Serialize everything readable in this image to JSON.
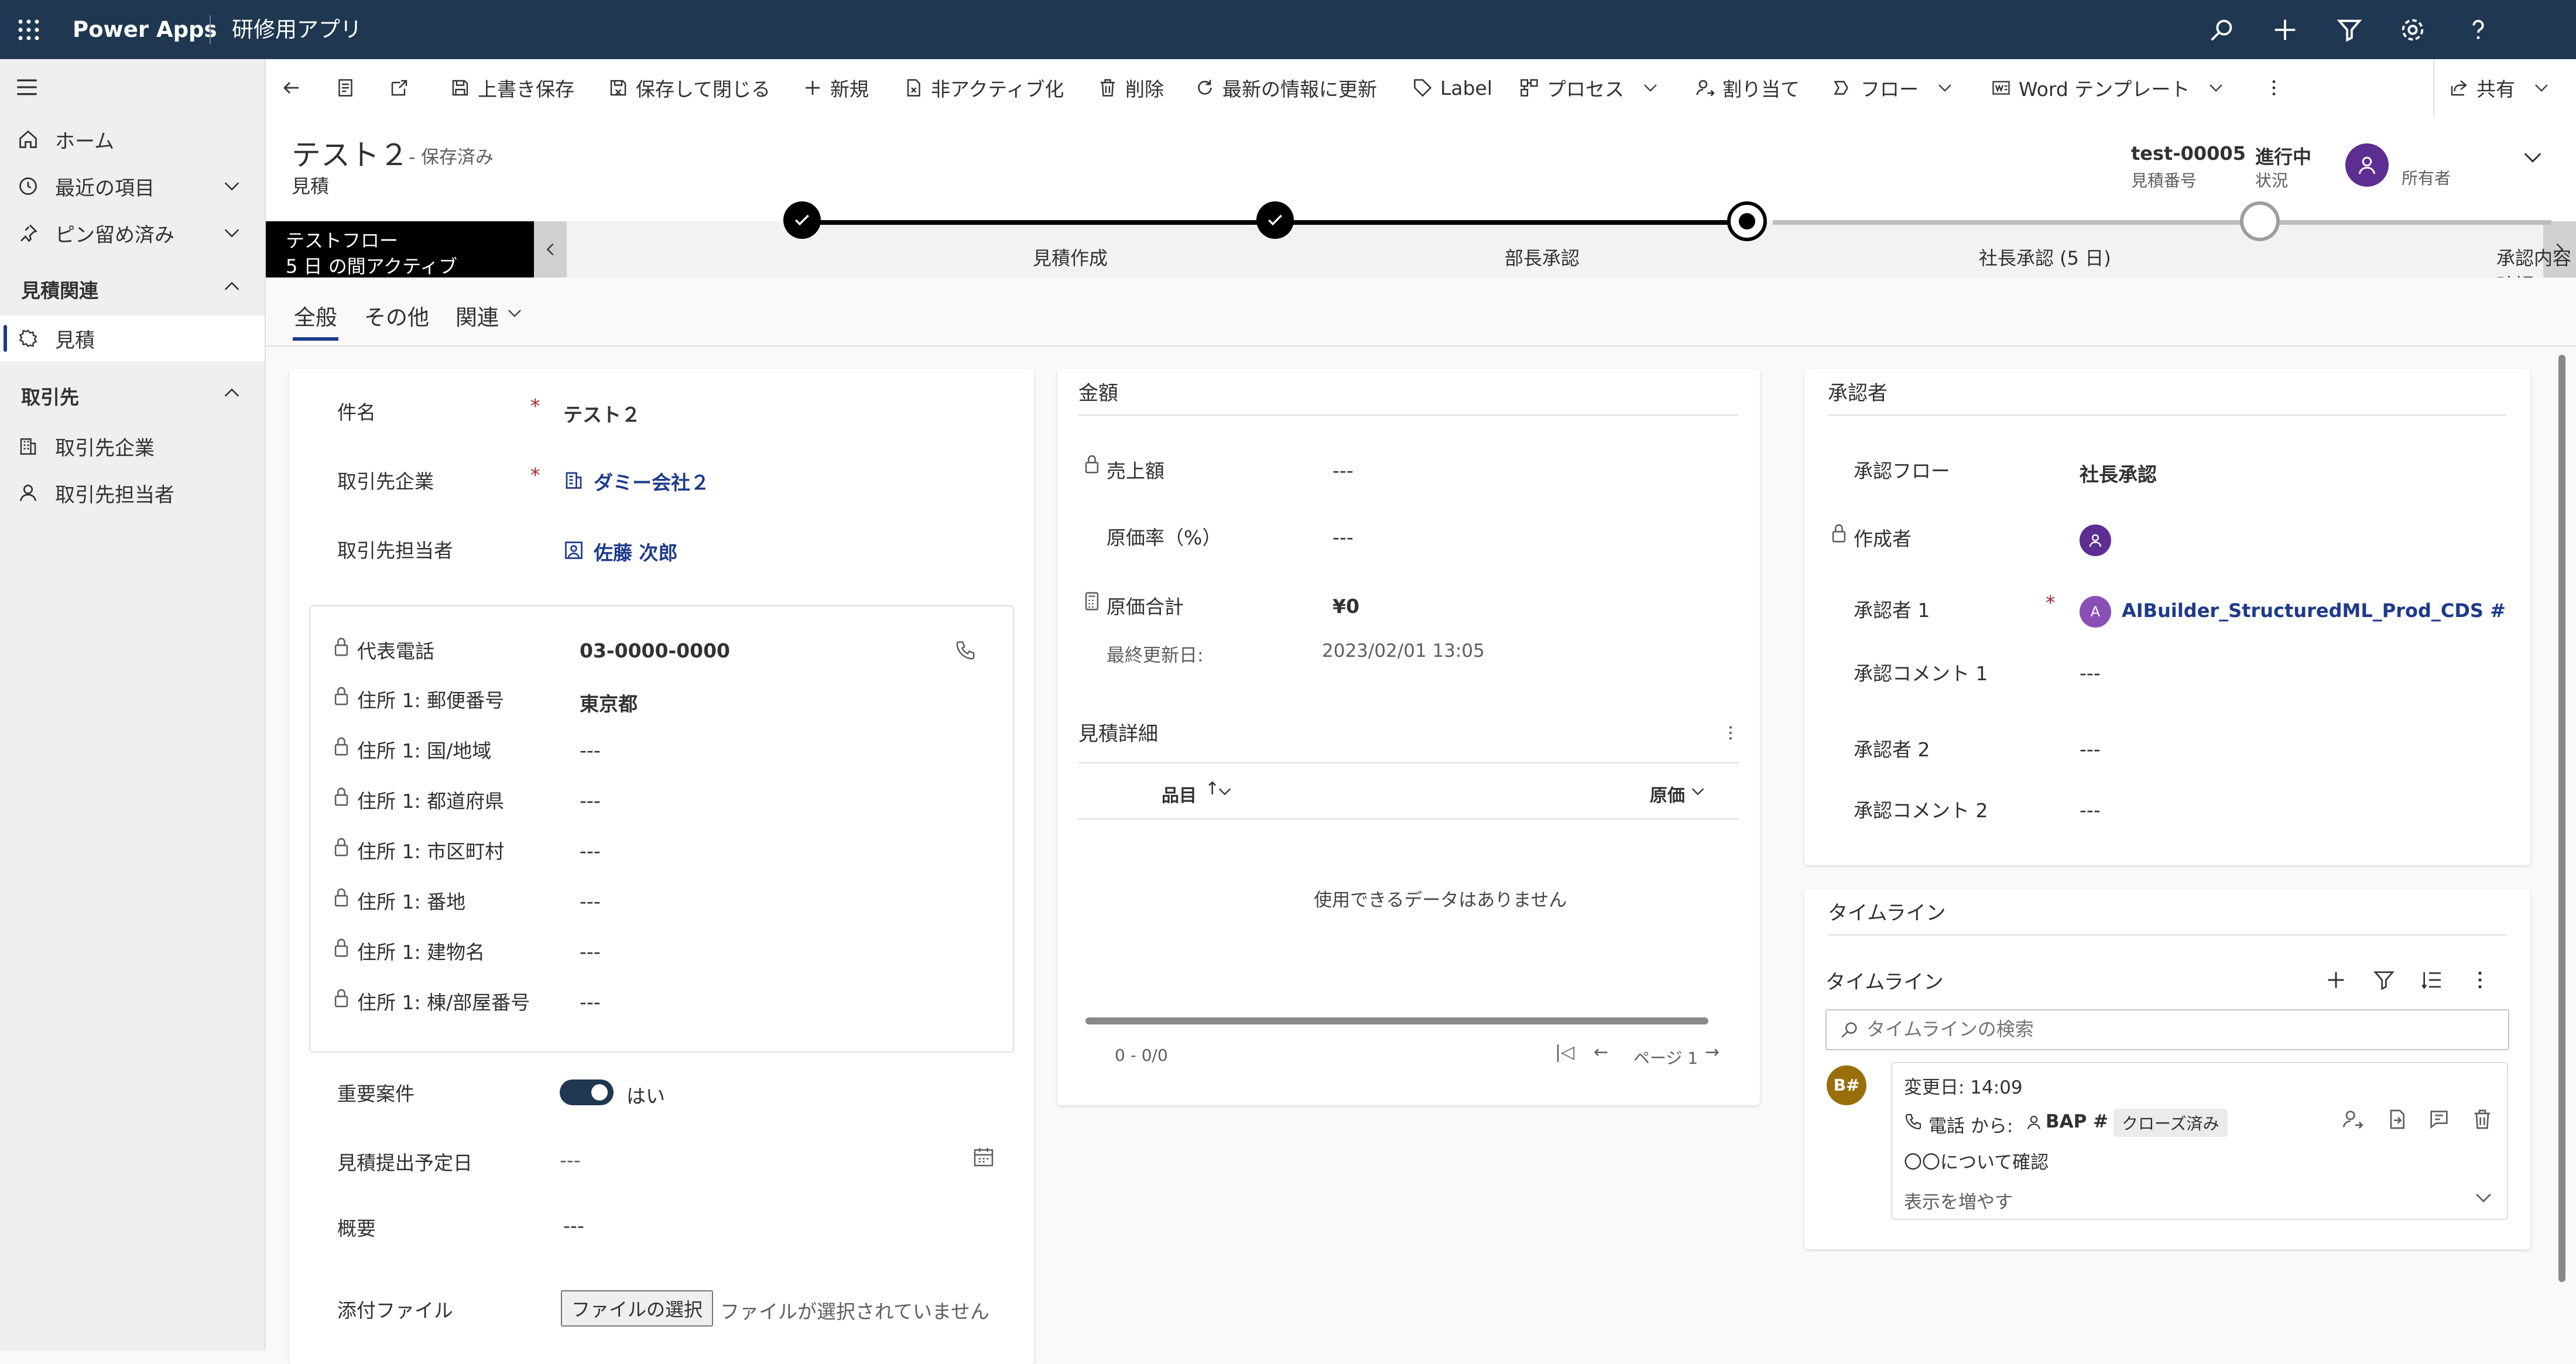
{
  "topbar": {
    "app_name": "Power Apps",
    "app_title": "研修用アプリ",
    "bg": "#1f3750"
  },
  "command_bar": {
    "save": "上書き保存",
    "save_close": "保存して閉じる",
    "new": "新規",
    "deactivate": "非アクティブ化",
    "delete": "削除",
    "refresh": "最新の情報に更新",
    "label": "Label",
    "process": "プロセス",
    "assign": "割り当て",
    "flow": "フロー",
    "word_template": "Word テンプレート",
    "share": "共有"
  },
  "sidebar": {
    "home": "ホーム",
    "recent": "最近の項目",
    "pinned": "ピン留め済み",
    "group1": "見積関連",
    "quote": "見積",
    "group2": "取引先",
    "account": "取引先企業",
    "contact": "取引先担当者"
  },
  "header": {
    "title": "テスト２",
    "saved": "- 保存済み",
    "entity": "見積",
    "quote_number": "test-00005",
    "quote_number_label": "見積番号",
    "status": "進行中",
    "status_label": "状況",
    "owner_label": "所有者"
  },
  "bpf": {
    "flow_name": "テストフロー",
    "active": "5 日 の間アクティブ",
    "stages": [
      {
        "label": "見積作成",
        "state": "done"
      },
      {
        "label": "部長承認",
        "state": "done"
      },
      {
        "label": "社長承認 (5 日)",
        "state": "current"
      },
      {
        "label": "承認内容確認",
        "state": "todo"
      }
    ]
  },
  "tabs": {
    "general": "全般",
    "other": "その他",
    "related": "関連"
  },
  "general": {
    "subject_label": "件名",
    "subject": "テスト２",
    "account_label": "取引先企業",
    "account": "ダミー会社２",
    "contact_label": "取引先担当者",
    "contact": "佐藤 次郎",
    "phone_label": "代表電話",
    "phone": "03-0000-0000",
    "zip_label": "住所 1: 郵便番号",
    "zip": "東京都",
    "country_label": "住所 1: 国/地域",
    "country": "---",
    "state_label": "住所 1: 都道府県",
    "state": "---",
    "city_label": "住所 1: 市区町村",
    "city": "---",
    "street_label": "住所 1: 番地",
    "street": "---",
    "building_label": "住所 1: 建物名",
    "building": "---",
    "room_label": "住所 1: 棟/部屋番号",
    "room": "---",
    "important_label": "重要案件",
    "important": "はい",
    "due_label": "見積提出予定日",
    "due": "---",
    "summary_label": "概要",
    "summary": "---",
    "attach_label": "添付ファイル",
    "attach_button": "ファイルの選択",
    "attach_none": "ファイルが選択されていません"
  },
  "amount": {
    "title": "金額",
    "sales_label": "売上額",
    "sales": "---",
    "cost_rate_label": "原価率（%）",
    "cost_rate": "---",
    "cost_total_label": "原価合計",
    "cost_total": "¥0",
    "updated_label": "最終更新日:",
    "updated": "2023/02/01 13:05"
  },
  "details": {
    "title": "見積詳細",
    "col_item": "品目",
    "col_cost": "原価",
    "empty": "使用できるデータはありません",
    "count": "0 - 0/0",
    "page": "ページ 1"
  },
  "approver": {
    "title": "承認者",
    "flow_label": "承認フロー",
    "flow": "社長承認",
    "creator_label": "作成者",
    "approver1_label": "承認者 1",
    "approver1": "AIBuilder_StructuredML_Prod_CDS #",
    "comment1_label": "承認コメント 1",
    "comment1": "---",
    "approver2_label": "承認者 2",
    "approver2": "---",
    "comment2_label": "承認コメント 2",
    "comment2": "---"
  },
  "timeline": {
    "section": "タイムライン",
    "title": "タイムライン",
    "search_placeholder": "タイムラインの検索",
    "avatar": "B#",
    "modified": "変更日: 14:09",
    "call_from": "電話 から:",
    "author": "BAP #",
    "closed": "クローズ済み",
    "subject": "〇〇について確認",
    "more": "表示を増やす"
  }
}
